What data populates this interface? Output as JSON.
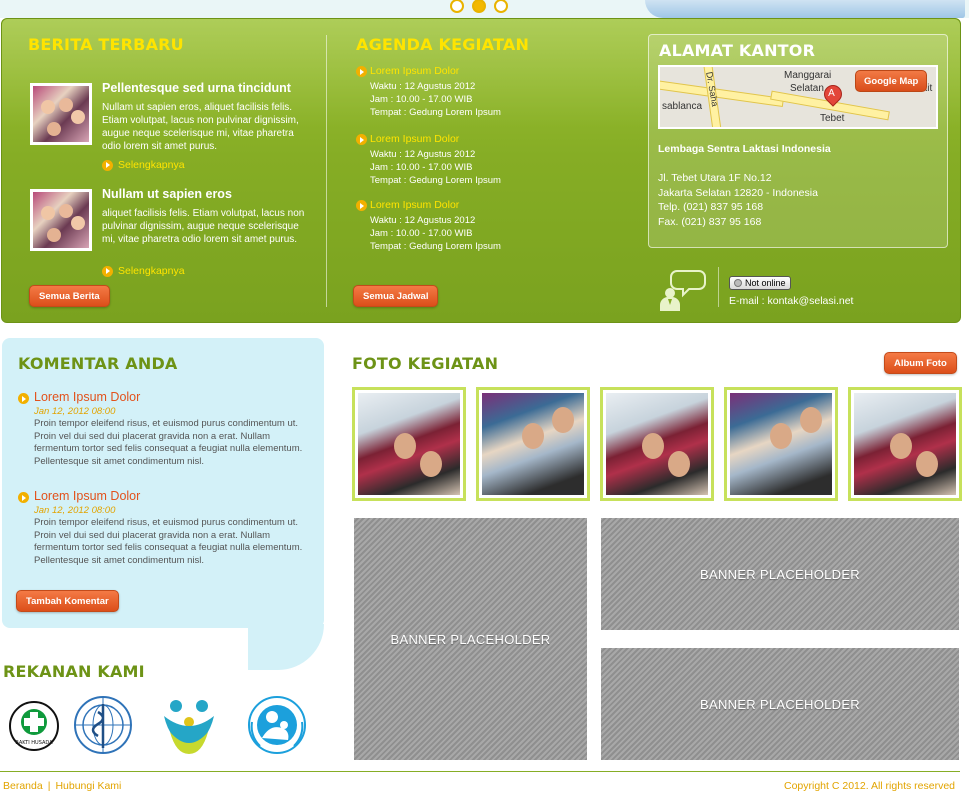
{
  "slider": {
    "dot_count": 3,
    "active_index": 1
  },
  "news": {
    "title": "BERITA TERBARU",
    "items": [
      {
        "title": "Pellentesque sed urna tincidunt",
        "body": "Nullam ut sapien eros, aliquet facilisis felis. Etiam volutpat, lacus non pulvinar dignissim, augue neque scelerisque mi, vitae pharetra odio lorem sit amet purus.",
        "more": "Selengkapnya"
      },
      {
        "title": "Nullam ut sapien eros",
        "body": "aliquet facilisis felis. Etiam volutpat, lacus non pulvinar dignissim, augue neque scelerisque mi, vitae pharetra odio lorem sit amet purus.",
        "more": "Selengkapnya"
      }
    ],
    "all_button": "Semua Berita"
  },
  "agenda": {
    "title": "AGENDA KEGIATAN",
    "items": [
      {
        "title": "Lorem Ipsum Dolor",
        "time_date": "Waktu : 12 Agustus 2012",
        "hours": "Jam : 10.00 - 17.00 WIB",
        "place": "Tempat : Gedung Lorem Ipsum"
      },
      {
        "title": "Lorem Ipsum Dolor",
        "time_date": "Waktu : 12 Agustus 2012",
        "hours": "Jam : 10.00 - 17.00 WIB",
        "place": "Tempat : Gedung Lorem Ipsum"
      },
      {
        "title": "Lorem Ipsum Dolor",
        "time_date": "Waktu : 12 Agustus 2012",
        "hours": "Jam : 10.00 - 17.00 WIB",
        "place": "Tempat : Gedung Lorem Ipsum"
      }
    ],
    "all_button": "Semua Jadwal"
  },
  "office": {
    "title": "ALAMAT KANTOR",
    "map_labels": {
      "area1": "Manggarai",
      "area2": "Selatan",
      "street1": "sablanca",
      "street2": "Dr. Saha",
      "area3": "Bukit",
      "area4": "Tebet",
      "pin": "A"
    },
    "map_button": "Google Map",
    "org": "Lembaga Sentra Laktasi Indonesia",
    "address1": "Jl. Tebet Utara 1F No.12",
    "address2": "Jakarta Selatan 12820 - Indonesia",
    "phone": "Telp. (021) 837 95 168",
    "fax": "Fax. (021) 837 95 168"
  },
  "contact": {
    "status": "Not online",
    "email": "E-mail : kontak@selasi.net"
  },
  "comments": {
    "title": "KOMENTAR ANDA",
    "items": [
      {
        "title": "Lorem Ipsum Dolor",
        "date": "Jan 12, 2012 08:00",
        "body": "Proin tempor eleifend risus, et euismod purus condimentum ut. Proin vel dui sed dui placerat gravida non a erat. Nullam fermentum tortor sed felis consequat a feugiat nulla elementum. Pellentesque sit amet condimentum nisl."
      },
      {
        "title": "Lorem Ipsum Dolor",
        "date": "Jan 12, 2012 08:00",
        "body": "Proin tempor eleifend risus, et euismod purus condimentum ut. Proin vel dui sed dui placerat gravida non a erat. Nullam fermentum tortor sed felis consequat a feugiat nulla elementum. Pellentesque sit amet condimentum nisl."
      }
    ],
    "add_button": "Tambah Komentar"
  },
  "partners": {
    "title": "REKANAN KAMI",
    "logos": [
      "bakti-husada-logo",
      "who-logo",
      "family-logo",
      "unicef-logo"
    ],
    "bakti_text": "BAKTI HUSADA"
  },
  "gallery": {
    "title": "FOTO KEGIATAN",
    "album_button": "Album Foto",
    "photo_count": 5
  },
  "banners": [
    "BANNER PLACEHOLDER",
    "BANNER PLACEHOLDER",
    "BANNER PLACEHOLDER"
  ],
  "footer": {
    "home": "Beranda",
    "separator": "|",
    "contact": "Hubungi Kami",
    "copyright": "Copyright C 2012. All rights reserved"
  },
  "colors": {
    "green": "#86ad25",
    "yellow_heading": "#ffe400",
    "orange_button": "#e2521c",
    "light_blue_panel": "#d3f1f8"
  }
}
